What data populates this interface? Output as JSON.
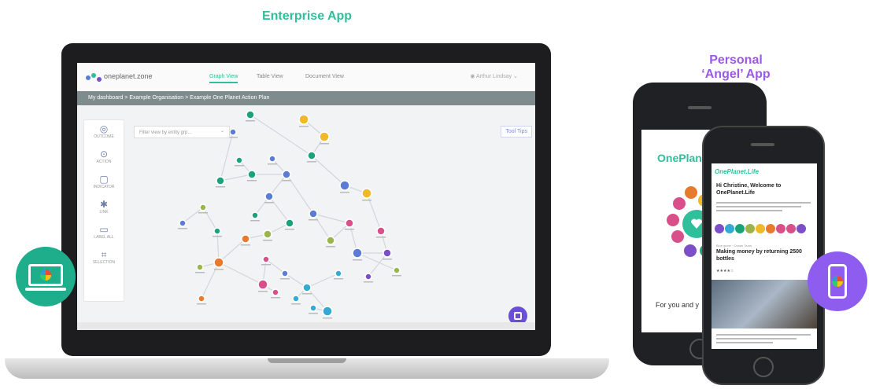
{
  "headings": {
    "enterprise": "Enterprise App",
    "personal_line1": "Personal",
    "personal_line2": "‘Angel’ App"
  },
  "enterprise_app": {
    "logo": "oneplanet.zone",
    "tabs": [
      "Graph View",
      "Table View",
      "Document View"
    ],
    "user": "Arthur Lindsay",
    "breadcrumb": "My dashboard > Example Organisation > Example One Planet Action Plan",
    "filter_placeholder": "Filter view by entity grp...",
    "tooltip_button": "Tool Tips",
    "tools": [
      {
        "icon": "outcome-icon",
        "label": "OUTCOME"
      },
      {
        "icon": "action-icon",
        "label": "ACTION"
      },
      {
        "icon": "indicator-icon",
        "label": "INDICATOR"
      },
      {
        "icon": "link-icon",
        "label": "LINK"
      },
      {
        "icon": "label-icon",
        "label": "LABEL ALL"
      },
      {
        "icon": "selection-icon",
        "label": "SELECTION"
      }
    ]
  },
  "personal_app": {
    "back_phone": {
      "brand": "OnePlanet",
      "tagline": "For you and y"
    },
    "front_phone": {
      "brand": "OnePlanet.",
      "brand_script": "Life",
      "greeting": "Hi Christine, Welcome to OnePlanet.Life",
      "article_tag": "Blue globe · Ocean Team",
      "article_title": "Making money by returning 2500 bottles",
      "rating": "★★★★☆"
    }
  },
  "colors": {
    "enterprise_green": "#2fbf9a",
    "personal_purple": "#9b59e6",
    "graph_node_palette": [
      "#1aa37a",
      "#5b7bd5",
      "#f1b827",
      "#d94f8a",
      "#e87a2d",
      "#9ab64a",
      "#34a9d4",
      "#7c4fc9"
    ]
  }
}
